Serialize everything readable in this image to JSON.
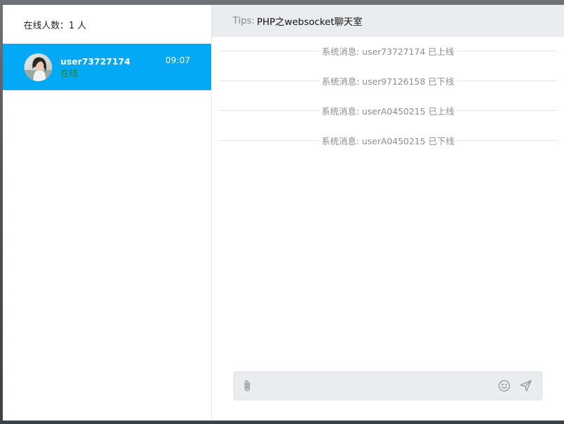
{
  "sidebar": {
    "online_count": "在线人数：1 人",
    "users": [
      {
        "name": "user73727174",
        "status": "在线",
        "time": "09:07"
      }
    ]
  },
  "header": {
    "tips_label": "Tips:",
    "tips_text": "PHP之websocket聊天室"
  },
  "messages": [
    {
      "text": "系统消息: user73727174 已上线"
    },
    {
      "text": "系统消息: user97126158 已下线"
    },
    {
      "text": "系统消息: userA0450215 已上线"
    },
    {
      "text": "系统消息: userA0450215 已下线"
    }
  ],
  "composer": {
    "placeholder": "",
    "attach_icon": "paperclip-icon",
    "emoji_icon": "smiley-icon",
    "send_icon": "send-icon"
  },
  "colors": {
    "accent": "#03a9f4",
    "online_status": "#2e7d32",
    "system_text": "#8c8c8c"
  }
}
